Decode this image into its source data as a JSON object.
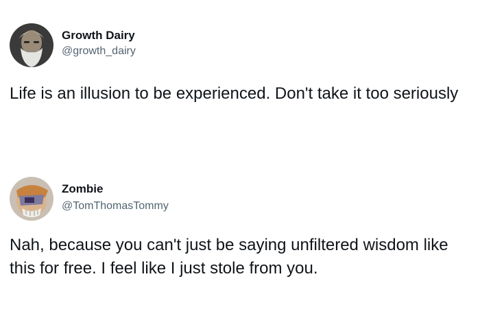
{
  "tweets": [
    {
      "author": {
        "display_name": "Growth Dairy",
        "handle": "@growth_dairy",
        "avatar": "bearded-old-man-avatar"
      },
      "text": "Life is an illusion to be experienced. Don't take it too seriously"
    },
    {
      "author": {
        "display_name": "Zombie",
        "handle": "@TomThomasTommy",
        "avatar": "zombie-cartoon-avatar"
      },
      "text": "Nah, because you can't just be saying unfiltered wisdom like this for free. I feel like I just stole from you."
    }
  ]
}
